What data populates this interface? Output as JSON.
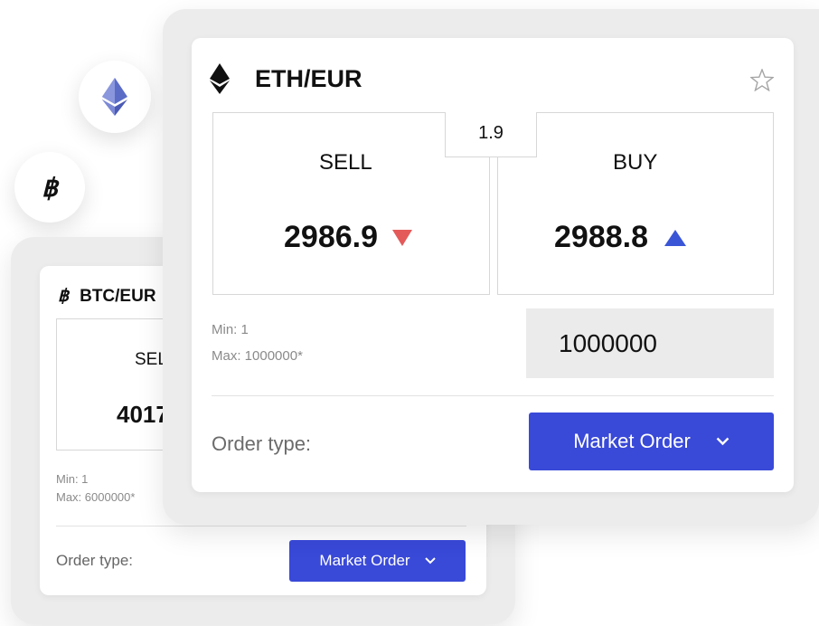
{
  "colors": {
    "accent": "#3949d8",
    "sell": "#e45a5a",
    "buy": "#3a55d6",
    "frame": "#ececec"
  },
  "btc_card": {
    "pair": "BTC/EUR",
    "sell_label": "SELL",
    "sell_price": "4017",
    "min_text": "Min: 1",
    "max_text": "Max: 6000000*",
    "order_type_label": "Order type:",
    "order_type_value": "Market Order",
    "icon": "bitcoin-icon"
  },
  "eth_card": {
    "pair": "ETH/EUR",
    "spread": "1.9",
    "sell_label": "SELL",
    "sell_price": "2986.9",
    "buy_label": "BUY",
    "buy_price": "2988.8",
    "min_text": "Min: 1",
    "max_text": "Max: 1000000*",
    "amount": "1000000",
    "order_type_label": "Order type:",
    "order_type_value": "Market Order",
    "icon": "ethereum-icon",
    "favorite_icon": "star-icon"
  }
}
